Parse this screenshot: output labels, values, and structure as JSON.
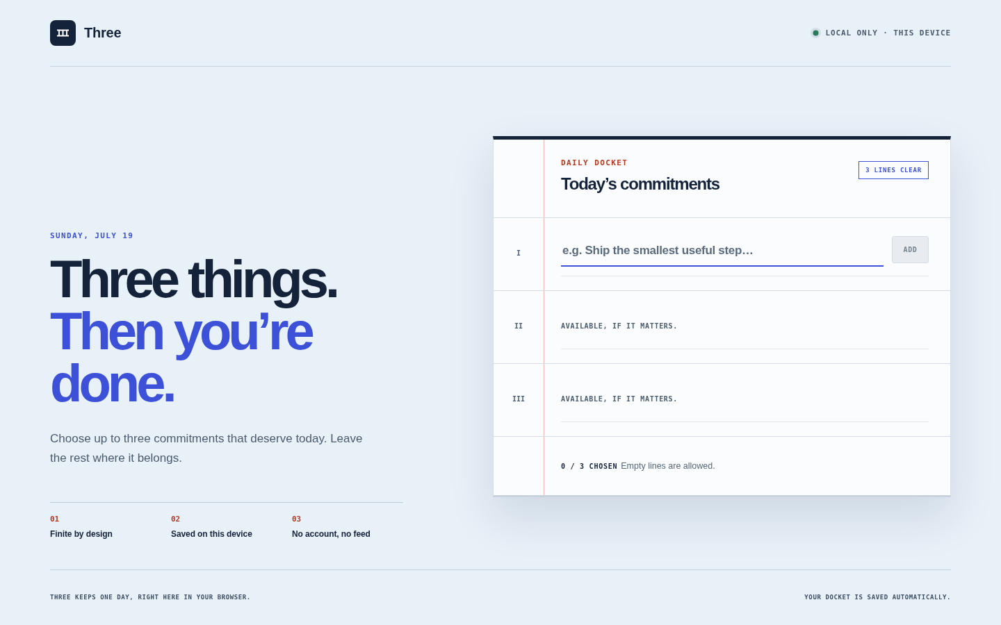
{
  "brand": {
    "name": "Three"
  },
  "status": {
    "label": "LOCAL ONLY · THIS DEVICE"
  },
  "intro": {
    "date": "SUNDAY, JULY 19",
    "headline": [
      {
        "text": "Three things.",
        "accent": false
      },
      {
        "text": "Then you’re",
        "accent": true
      },
      {
        "text": "done.",
        "accent": true
      }
    ],
    "body": "Choose up to three commitments that deserve today. Leave the rest where it belongs.",
    "features": [
      {
        "number": "01",
        "label": "Finite by design"
      },
      {
        "number": "02",
        "label": "Saved on this device"
      },
      {
        "number": "03",
        "label": "No account, no feed"
      }
    ]
  },
  "docket": {
    "eyebrow": "DAILY DOCKET",
    "title": "Today’s commitments",
    "badge": "3 LINES CLEAR",
    "lines": [
      {
        "numeral": "I",
        "kind": "entry",
        "placeholder": "e.g. Ship the smallest useful step…",
        "focused": true,
        "button": {
          "label": "ADD",
          "disabled": true
        }
      },
      {
        "numeral": "II",
        "kind": "open",
        "text": "AVAILABLE, IF IT MATTERS."
      },
      {
        "numeral": "III",
        "kind": "open",
        "text": "AVAILABLE, IF IT MATTERS."
      }
    ],
    "count": "0 / 3 CHOSEN",
    "note": "Empty lines are allowed."
  },
  "footer": {
    "left": "THREE KEEPS ONE DAY, RIGHT HERE IN YOUR BROWSER.",
    "right": "YOUR DOCKET IS SAVED AUTOMATICALLY."
  }
}
